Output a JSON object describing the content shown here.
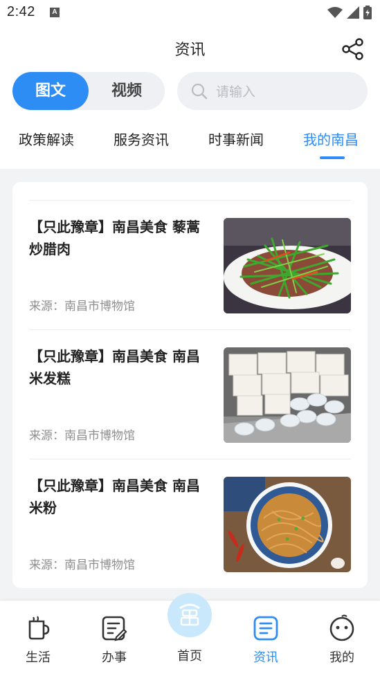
{
  "status_bar": {
    "time": "2:42",
    "notif_letter": "A"
  },
  "header": {
    "title": "资讯",
    "share_icon": "share-icon"
  },
  "content_type": {
    "options": [
      "图文",
      "视频"
    ],
    "selected": "图文"
  },
  "search": {
    "placeholder": "请输入",
    "icon": "search-icon"
  },
  "category_tabs": [
    {
      "label": "政策解读",
      "active": false
    },
    {
      "label": "服务资讯",
      "active": false
    },
    {
      "label": "时事新闻",
      "active": false
    },
    {
      "label": "我的南昌",
      "active": true
    }
  ],
  "articles": [
    {
      "title": "【只此豫章】南昌美食 藜蒿炒腊肉",
      "source": "来源：南昌市博物馆"
    },
    {
      "title": "【只此豫章】南昌美食 南昌米发糕",
      "source": "来源：南昌市博物馆"
    },
    {
      "title": "【只此豫章】南昌美食 南昌米粉",
      "source": "来源：南昌市博物馆"
    }
  ],
  "bottom_nav": [
    {
      "label": "生活",
      "icon": "coffee-cup-icon",
      "active": false
    },
    {
      "label": "办事",
      "icon": "edit-document-icon",
      "active": false
    },
    {
      "label": "首页",
      "icon": "home-logo-icon",
      "active": false
    },
    {
      "label": "资讯",
      "icon": "news-list-icon",
      "active": true
    },
    {
      "label": "我的",
      "icon": "smiley-face-icon",
      "active": false
    }
  ],
  "colors": {
    "accent": "#2e8cf5",
    "background": "#f2f3f5",
    "home_circle": "#c9e8fb"
  }
}
